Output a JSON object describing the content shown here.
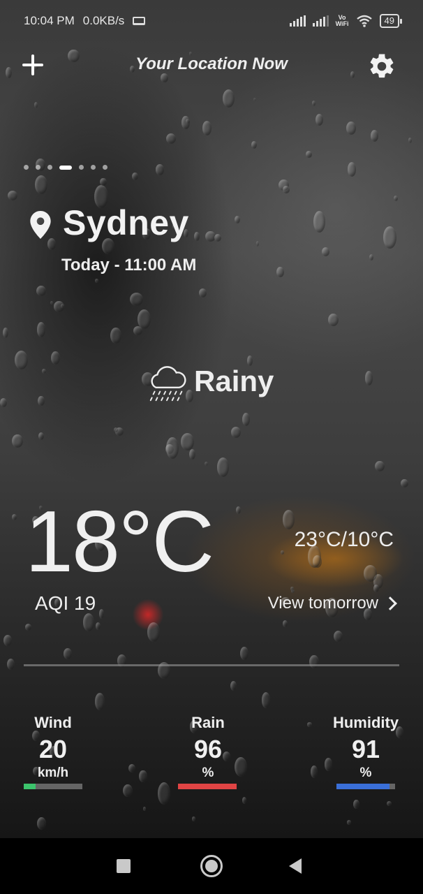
{
  "status_bar": {
    "time": "10:04 PM",
    "speed": "0.0KB/s",
    "vowifi_top": "Vo",
    "vowifi_bottom": "WiFi",
    "battery": "49"
  },
  "header": {
    "title": "Your Location Now",
    "add_icon": "plus-icon",
    "settings_icon": "gear-icon"
  },
  "pager": {
    "count": 7,
    "active_index": 3
  },
  "location": {
    "city": "Sydney",
    "datetime": "Today - 11:00 AM"
  },
  "condition": {
    "label": "Rainy",
    "icon": "rain-cloud-icon"
  },
  "temperature": {
    "current": "18°C",
    "high_low": "23°C/10°C",
    "aqi": "AQI 19",
    "view_tomorrow": "View tomorrow"
  },
  "stats": [
    {
      "label": "Wind",
      "value": "20",
      "unit": "km/h",
      "level": 0.2,
      "color": "#3cc46c"
    },
    {
      "label": "Rain",
      "value": "96",
      "unit": "%",
      "level": 1.0,
      "color": "#e04444"
    },
    {
      "label": "Humidity",
      "value": "91",
      "unit": "%",
      "level": 0.91,
      "color": "#3a6fd8"
    }
  ],
  "colors": {
    "text": "#ffffff",
    "wind_bar": "#3cc46c",
    "rain_bar": "#e04444",
    "humidity_bar": "#3a6fd8"
  }
}
